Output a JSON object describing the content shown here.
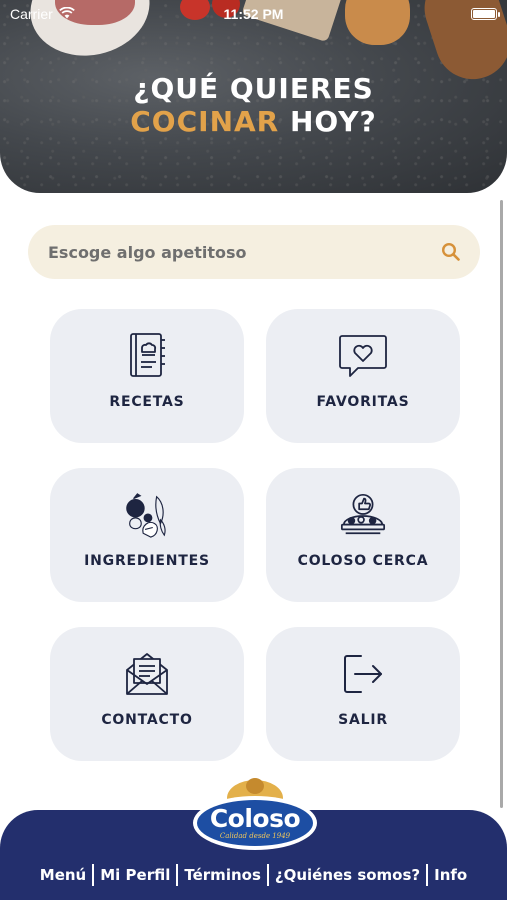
{
  "status_bar": {
    "carrier": "Carrier",
    "time": "11:52 PM"
  },
  "hero": {
    "title_line1": "¿QUÉ QUIERES",
    "title_accent": "COCINAR",
    "title_rest": "HOY?"
  },
  "search": {
    "placeholder": "Escoge algo apetitoso",
    "icon": "search-icon"
  },
  "tiles": [
    {
      "label": "RECETAS",
      "icon": "recipe-book-icon"
    },
    {
      "label": "FAVORITAS",
      "icon": "heart-chat-icon"
    },
    {
      "label": "INGREDIENTES",
      "icon": "vegetables-icon"
    },
    {
      "label": "COLOSO CERCA",
      "icon": "store-thumbs-up-icon"
    },
    {
      "label": "CONTACTO",
      "icon": "envelope-icon"
    },
    {
      "label": "SALIR",
      "icon": "logout-icon"
    }
  ],
  "footer": {
    "logo_name": "Coloso",
    "logo_tagline": "Calidad desde 1949",
    "links": [
      "Menú",
      "Mi Perfil",
      "Términos",
      "¿Quiénes somos?",
      "Info"
    ]
  },
  "colors": {
    "navy": "#232f6d",
    "accent": "#e2a24a",
    "tile_bg": "#eceef3",
    "search_bg": "#f5efe0"
  }
}
